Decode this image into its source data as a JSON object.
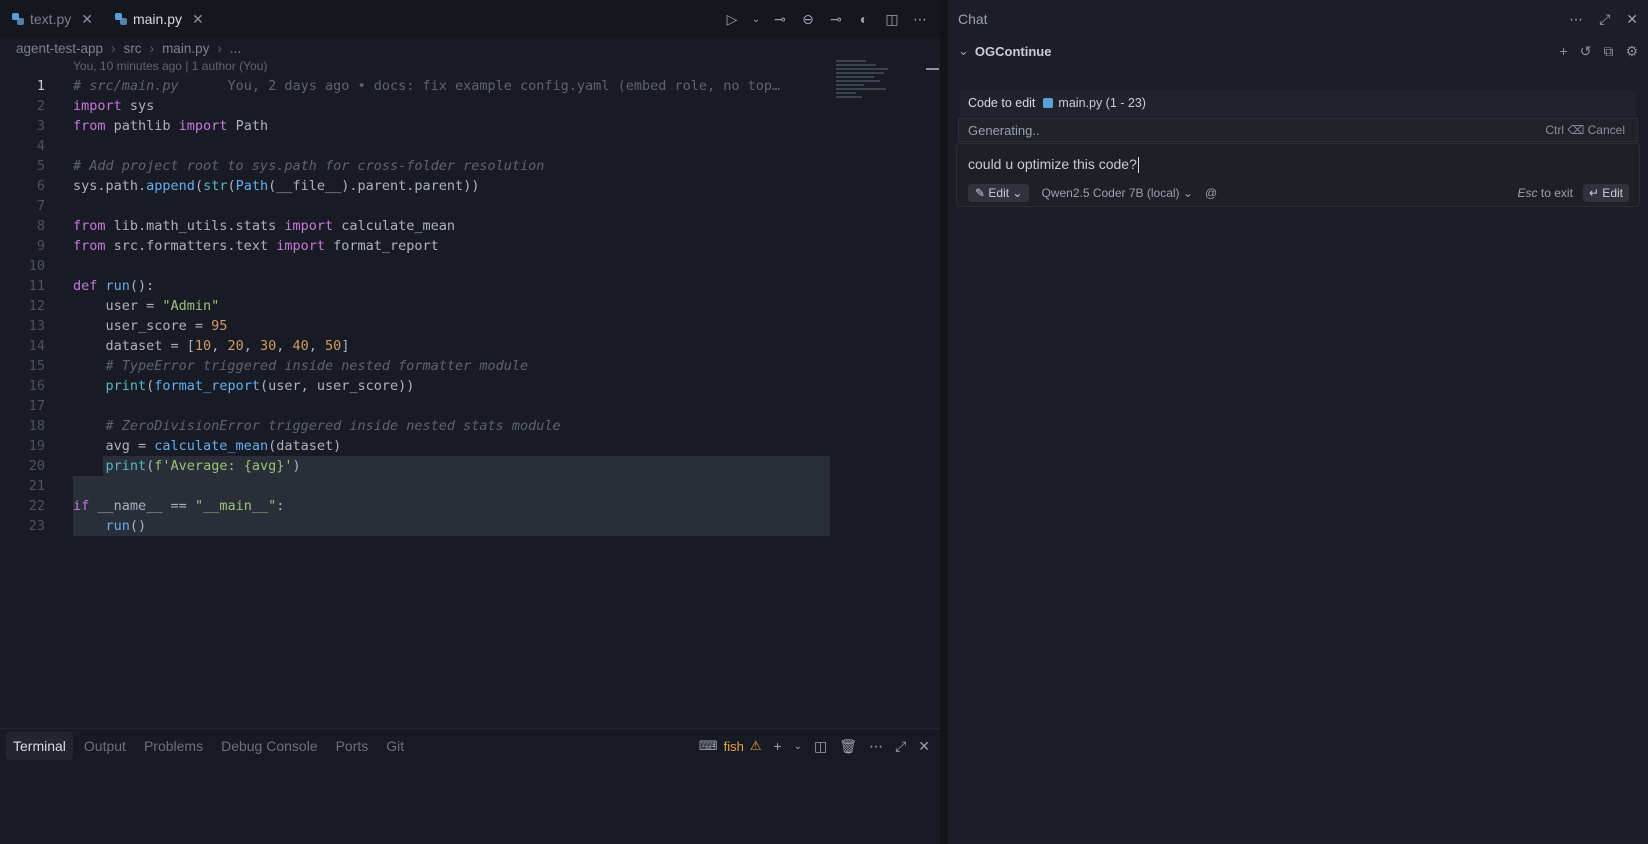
{
  "editor": {
    "tabs": [
      {
        "label": "text.py",
        "active": false
      },
      {
        "label": "main.py",
        "active": true
      }
    ],
    "breadcrumb": [
      "agent-test-app",
      "src",
      "main.py",
      "..."
    ],
    "blame_header": "You, 10 minutes ago | 1 author (You)",
    "inline_blame": "You, 2 days ago • docs: fix example config.yaml (embed role, no top…",
    "current_line": 1,
    "selection_lines": [
      20,
      23
    ],
    "lines": [
      "# src/main.py",
      "import sys",
      "from pathlib import Path",
      "",
      "# Add project root to sys.path for cross-folder resolution",
      "sys.path.append(str(Path(__file__).parent.parent))",
      "",
      "from lib.math_utils.stats import calculate_mean",
      "from src.formatters.text import format_report",
      "",
      "def run():",
      "    user = \"Admin\"",
      "    user_score = 95",
      "    dataset = [10, 20, 30, 40, 50]",
      "    # TypeError triggered inside nested formatter module",
      "    print(format_report(user, user_score))",
      "",
      "    # ZeroDivisionError triggered inside nested stats module",
      "    avg = calculate_mean(dataset)",
      "    print(f'Average: {avg}')",
      "",
      "if __name__ == \"__main__\":",
      "    run()"
    ]
  },
  "panel": {
    "tabs": [
      "Terminal",
      "Output",
      "Problems",
      "Debug Console",
      "Ports",
      "Git"
    ],
    "active_tab": "Terminal",
    "shell": "fish"
  },
  "chat": {
    "title": "Chat",
    "section": "OGContinue",
    "code_to_edit_label": "Code to edit",
    "code_to_edit_file": "main.py (1 - 23)",
    "status": "Generating..",
    "cancel_hint": "Ctrl ⌫ Cancel",
    "prompt": "could u optimize this code?",
    "mode": "Edit",
    "model": "Qwen2.5 Coder 7B (local)",
    "mention": "@",
    "esc_key": "Esc",
    "esc_text": "to exit",
    "edit_button": "↵ Edit"
  }
}
